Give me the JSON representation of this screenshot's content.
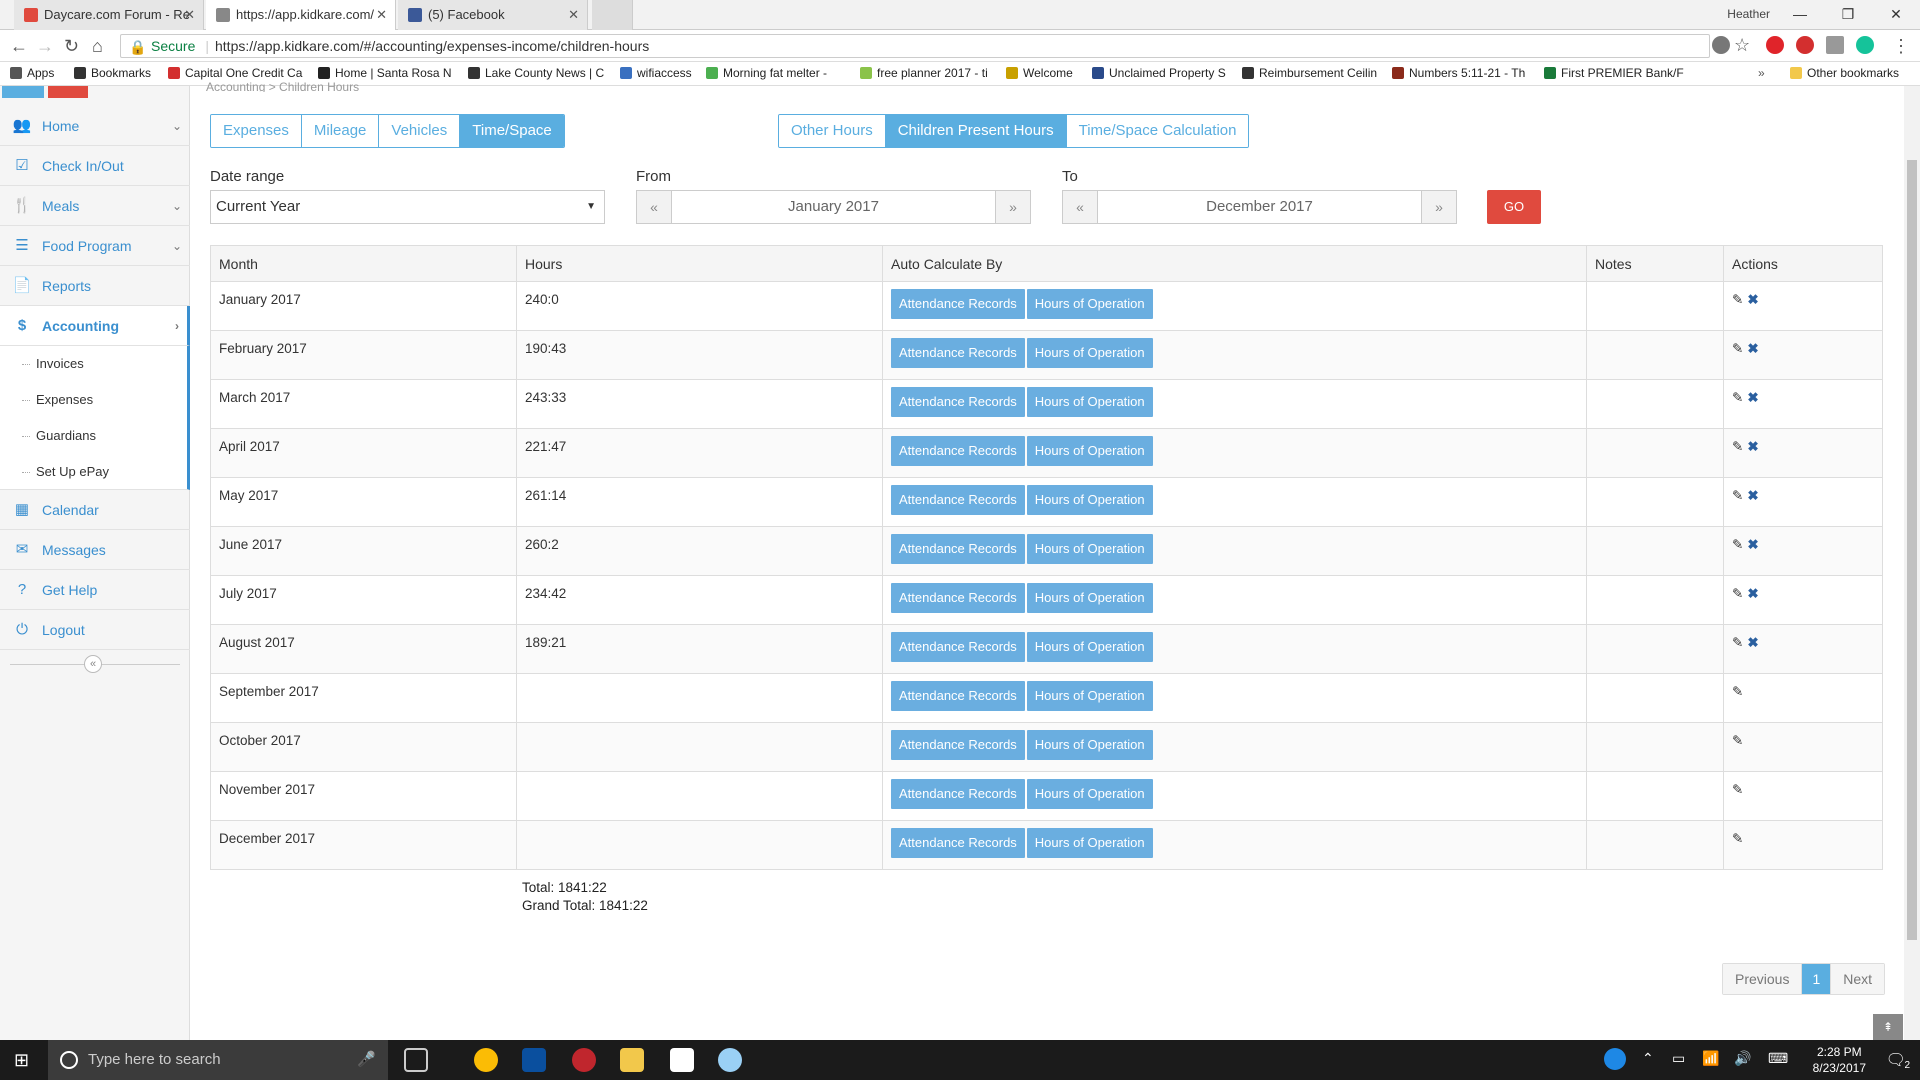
{
  "browser": {
    "tabs": [
      {
        "title": "Daycare.com Forum - Re",
        "color": "#e04a3e"
      },
      {
        "title": "https://app.kidkare.com/",
        "color": "#888888"
      },
      {
        "title": "(5) Facebook",
        "color": "#3b5998"
      }
    ],
    "user": "Heather",
    "secure_label": "Secure",
    "url": "https://app.kidkare.com/#/accounting/expenses-income/children-hours",
    "bookmarks": [
      "Apps",
      "Bookmarks",
      "Capital One Credit Ca",
      "Home | Santa Rosa N",
      "Lake County News | C",
      "wifiaccess",
      "Morning fat melter -",
      "free planner 2017 - ti",
      "Welcome",
      "Unclaimed Property S",
      "Reimbursement Ceilin",
      "Numbers 5:11-21 - Th",
      "First PREMIER Bank/F",
      "Other bookmarks"
    ]
  },
  "breadcrumb": "Accounting > Children Hours",
  "sidebar": {
    "items": [
      {
        "label": "Home",
        "icon": "users-icon"
      },
      {
        "label": "Check In/Out",
        "icon": "checkbox-icon"
      },
      {
        "label": "Meals",
        "icon": "utensils-icon"
      },
      {
        "label": "Food Program",
        "icon": "list-icon"
      },
      {
        "label": "Reports",
        "icon": "report-icon"
      },
      {
        "label": "Accounting",
        "icon": "dollar-icon"
      },
      {
        "label": "Calendar",
        "icon": "calendar-icon"
      },
      {
        "label": "Messages",
        "icon": "envelope-icon"
      },
      {
        "label": "Get Help",
        "icon": "help-icon"
      },
      {
        "label": "Logout",
        "icon": "power-icon"
      }
    ],
    "subitems": [
      "Invoices",
      "Expenses",
      "Guardians",
      "Set Up ePay"
    ]
  },
  "tabs_left": [
    "Expenses",
    "Mileage",
    "Vehicles",
    "Time/Space"
  ],
  "tabs_right": [
    "Other Hours",
    "Children Present Hours",
    "Time/Space Calculation"
  ],
  "filters": {
    "date_range_label": "Date range",
    "date_range_value": "Current Year",
    "from_label": "From",
    "from_value": "January 2017",
    "to_label": "To",
    "to_value": "December 2017",
    "go_label": "GO"
  },
  "table": {
    "headers": [
      "Month",
      "Hours",
      "Auto Calculate By",
      "Notes",
      "Actions"
    ],
    "btn_attendance": "Attendance Records",
    "btn_hours": "Hours of Operation",
    "rows": [
      {
        "month": "January 2017",
        "hours": "240:0"
      },
      {
        "month": "February 2017",
        "hours": "190:43"
      },
      {
        "month": "March 2017",
        "hours": "243:33"
      },
      {
        "month": "April 2017",
        "hours": "221:47"
      },
      {
        "month": "May 2017",
        "hours": "261:14"
      },
      {
        "month": "June 2017",
        "hours": "260:2"
      },
      {
        "month": "July 2017",
        "hours": "234:42"
      },
      {
        "month": "August 2017",
        "hours": "189:21"
      },
      {
        "month": "September 2017",
        "hours": ""
      },
      {
        "month": "October 2017",
        "hours": ""
      },
      {
        "month": "November 2017",
        "hours": ""
      },
      {
        "month": "December 2017",
        "hours": ""
      }
    ],
    "total": "Total: 1841:22",
    "grand_total": "Grand Total: 1841:22"
  },
  "pager": {
    "previous": "Previous",
    "current": "1",
    "next": "Next"
  },
  "taskbar": {
    "search_placeholder": "Type here to search",
    "time": "2:28 PM",
    "date": "8/23/2017",
    "notif_count": "2"
  },
  "colors": {
    "accent": "#5aaee0",
    "go": "#e04a3e"
  }
}
